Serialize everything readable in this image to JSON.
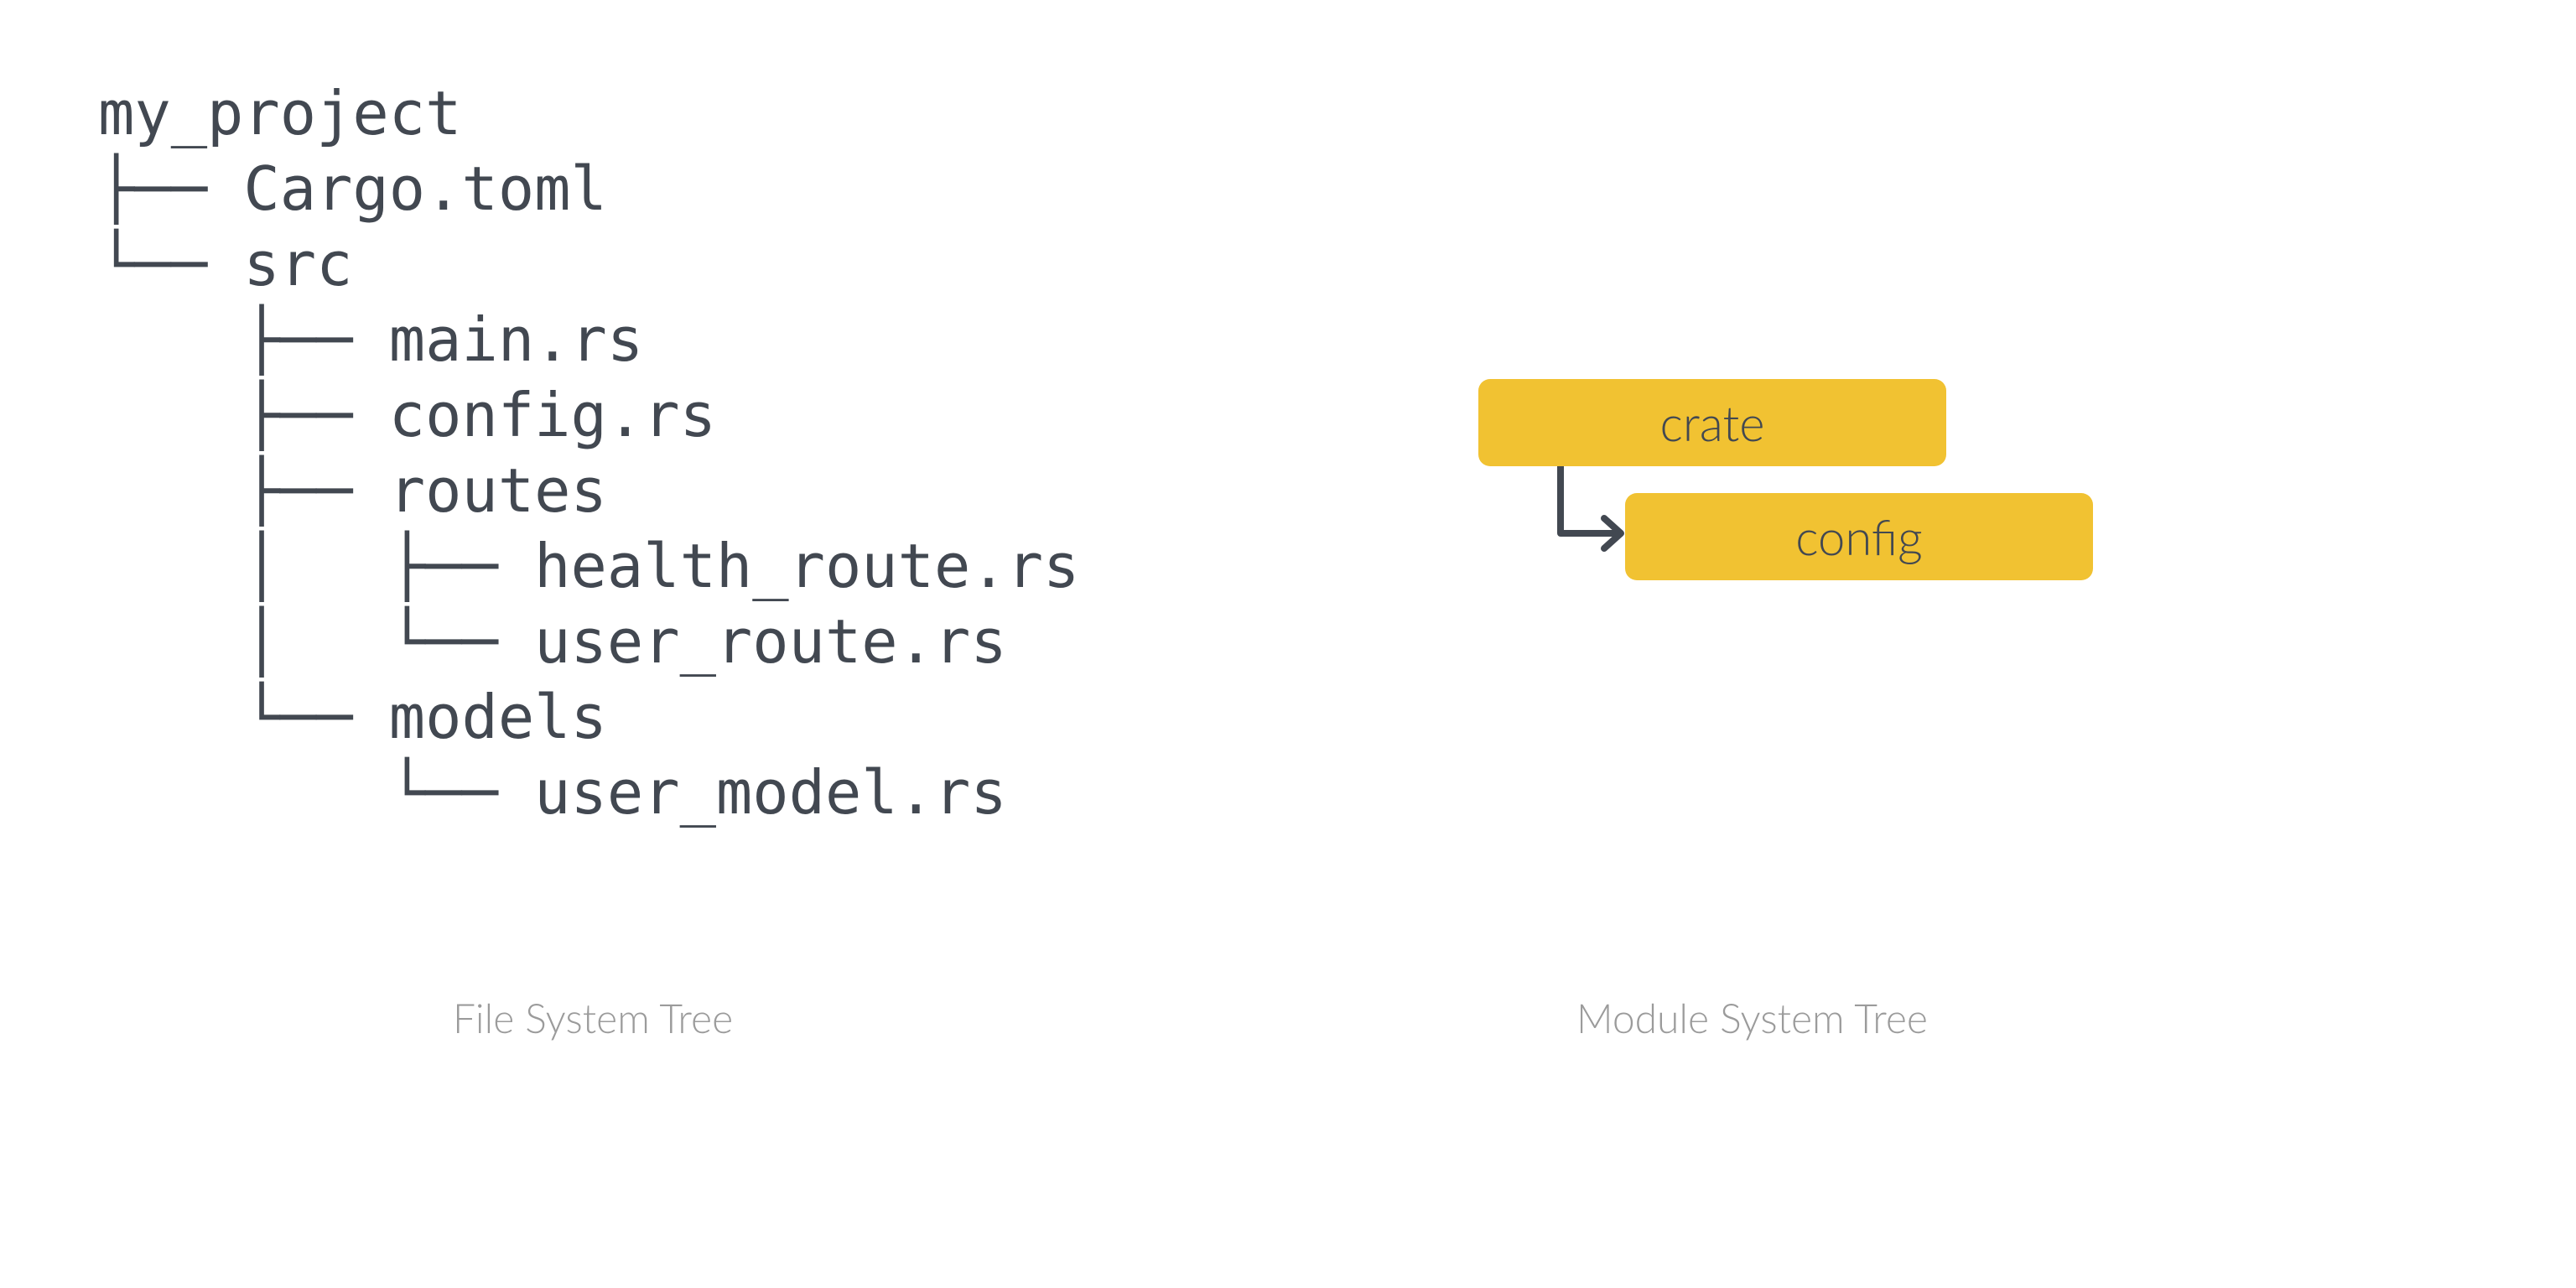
{
  "colors": {
    "text": "#424851",
    "muted": "#9b9b9b",
    "box": "#f1c232",
    "bg": "#ffffff"
  },
  "captions": {
    "left": "File System Tree",
    "right": "Module System Tree"
  },
  "tree": {
    "root": "my_project",
    "children": [
      "├── Cargo.toml",
      "└── src",
      "    ├── main.rs",
      "    ├── config.rs",
      "    ├── routes",
      "    │   ├── health_route.rs",
      "    │   └── user_route.rs",
      "    └── models",
      "        └── user_model.rs"
    ]
  },
  "modules": {
    "root": "crate",
    "child": "config"
  }
}
